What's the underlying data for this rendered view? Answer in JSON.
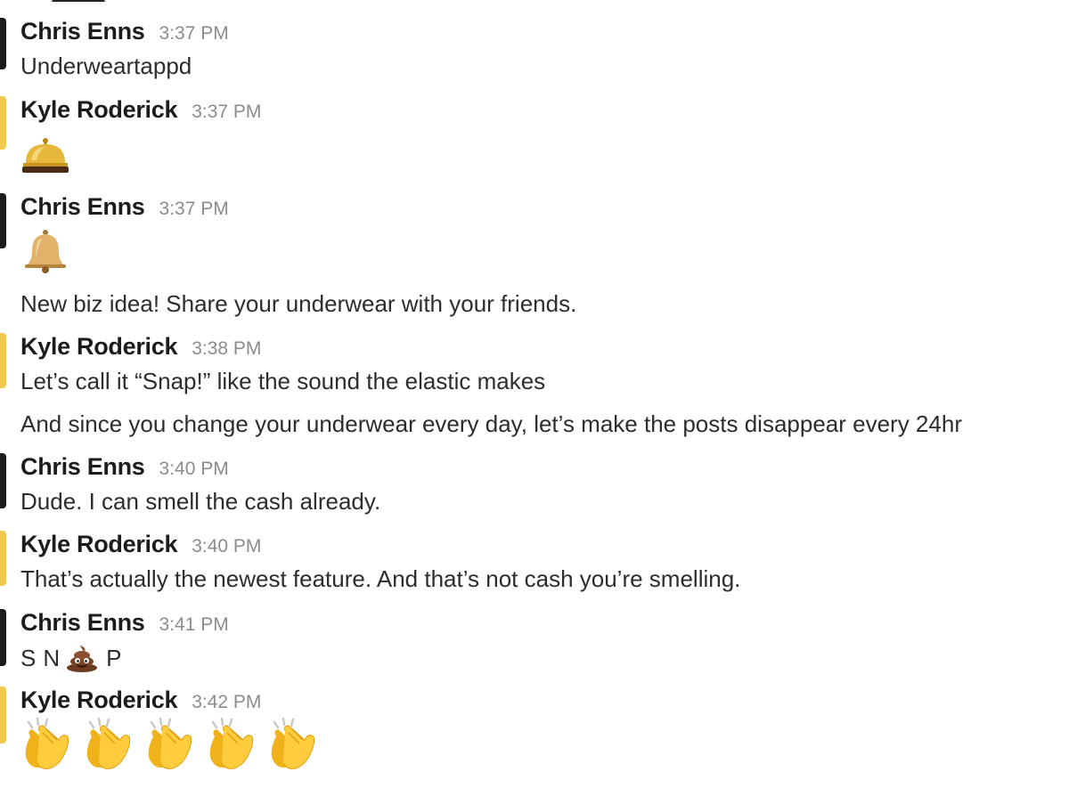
{
  "messages": [
    {
      "author": "Chris Enns",
      "time": "3:37 PM",
      "text": "Underweartappd"
    },
    {
      "author": "Kyle Roderick",
      "time": "3:37 PM",
      "emoji": "bellhop-bell-icon"
    },
    {
      "author": "Chris Enns",
      "time": "3:37 PM",
      "emoji": "bell-icon",
      "text": "New biz idea! Share your underwear with your friends."
    },
    {
      "author": "Kyle Roderick",
      "time": "3:38 PM",
      "text": "Let’s call it “Snap!” like the sound the elastic makes",
      "text2": "And since you change your underwear every day, let’s make the posts disappear every 24hr"
    },
    {
      "author": "Chris Enns",
      "time": "3:40 PM",
      "text": "Dude. I can smell the cash already."
    },
    {
      "author": "Kyle Roderick",
      "time": "3:40 PM",
      "text": "That’s actually the newest feature. And that’s not cash you’re smelling."
    },
    {
      "author": "Chris Enns",
      "time": "3:41 PM",
      "snp": {
        "s": "S",
        "n": "N",
        "p": "P",
        "emoji": "pile-of-poo-icon"
      }
    },
    {
      "author": "Kyle Roderick",
      "time": "3:42 PM",
      "emoji": "clapping-hands-icon",
      "emoji_count": 5
    }
  ],
  "colors": {
    "chris_edge": "#1d1c1d",
    "kyle_edge": "#f2c94c",
    "timestamp": "#8c8c8c"
  }
}
